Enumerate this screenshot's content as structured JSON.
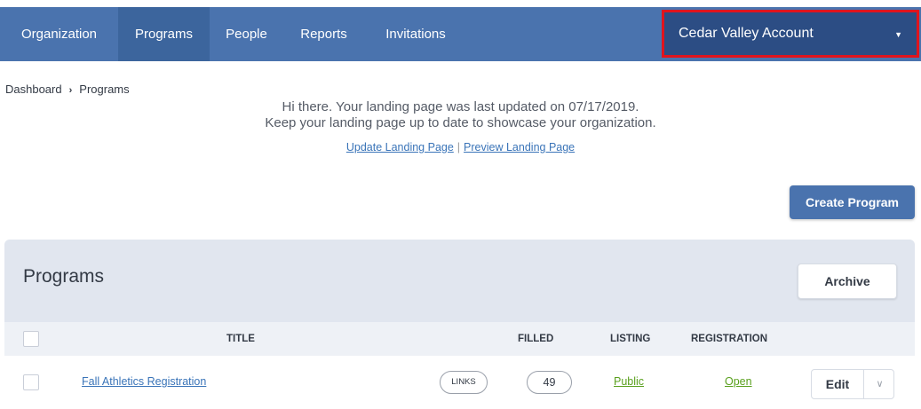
{
  "nav": {
    "items": [
      {
        "label": "Organization"
      },
      {
        "label": "Programs"
      },
      {
        "label": "People"
      },
      {
        "label": "Reports"
      },
      {
        "label": "Invitations"
      }
    ],
    "active": "Programs",
    "account": {
      "label": "Cedar Valley Account",
      "caret_icon": "chevron-down-icon"
    }
  },
  "breadcrumb": {
    "items": [
      "Dashboard",
      "Programs"
    ],
    "separator": "›"
  },
  "notice": {
    "line1": "Hi there. Your landing page was last updated on 07/17/2019.",
    "line2": "Keep your landing page up to date to showcase your organization.",
    "update_link": "Update Landing Page",
    "divider": "|",
    "preview_link": "Preview Landing Page"
  },
  "actions": {
    "create_program": "Create Program"
  },
  "programs": {
    "title": "Programs",
    "archive_label": "Archive",
    "columns": {
      "title": "TITLE",
      "filled": "FILLED",
      "listing": "LISTING",
      "registration": "REGISTRATION"
    },
    "rows": [
      {
        "title": "Fall Athletics Registration",
        "links_label": "LINKS",
        "filled": "49",
        "listing": "Public",
        "registration": "Open",
        "edit_label": "Edit"
      }
    ]
  },
  "colors": {
    "nav": "#4a73ae",
    "nav_active": "#3c659d",
    "account": "#2c4d84",
    "highlight": "#e0141e",
    "link": "#3a74b8",
    "green": "#5aa01e"
  }
}
